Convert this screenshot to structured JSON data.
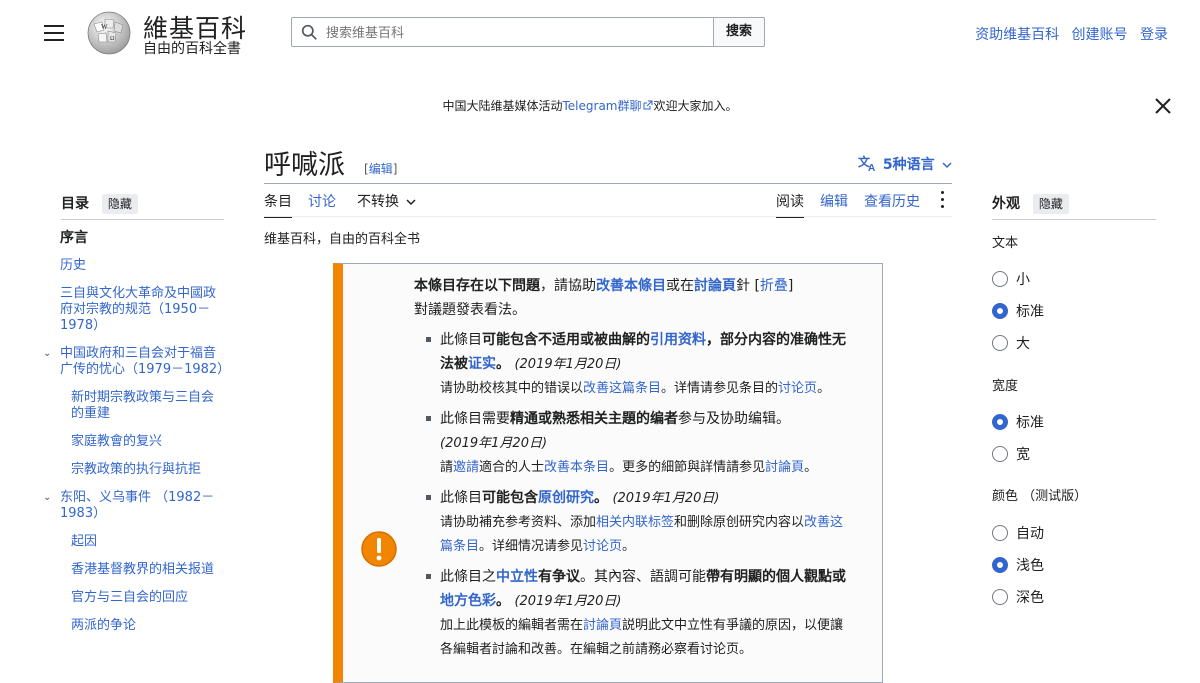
{
  "header": {
    "logo_name": "維基百科",
    "logo_tagline": "自由的百科全書",
    "search_placeholder": "搜索维基百科",
    "search_button": "搜索",
    "user_links": [
      "资助维基百科",
      "创建账号",
      "登录"
    ]
  },
  "banner": {
    "before": "中国大陆维基媒体活动",
    "link": "Telegram群聊",
    "after": "欢迎大家加入。"
  },
  "page": {
    "title": "呼喊派",
    "edit_label": "编辑",
    "languages": "5种语言",
    "from": "维基百科，自由的百科全书"
  },
  "tabs": {
    "left": [
      "条目",
      "讨论",
      "不转换"
    ],
    "right": [
      "阅读",
      "编辑",
      "查看历史"
    ]
  },
  "toc": {
    "title": "目录",
    "hide": "隐藏",
    "items": [
      "序言",
      "历史",
      "三自與文化大革命及中國政府对宗教的规范（1950－1978）",
      "中国政府和三自会对于福音广传的忧心（1979－1982）",
      "新时期宗教政策与三自会的重建",
      "家庭教會的复兴",
      "宗教政策的执行與抗拒",
      "东阳、义乌事件 （1982－1983）",
      "起因",
      "香港基督教界的相关报道",
      "官方与三自会的回应",
      "两派的争论"
    ]
  },
  "appearance": {
    "title": "外观",
    "hide": "隐藏",
    "text_label": "文本",
    "text_options": [
      "小",
      "标准",
      "大"
    ],
    "width_label": "宽度",
    "width_options": [
      "标准",
      "宽"
    ],
    "color_label": "颜色 （测试版）",
    "color_options": [
      "自动",
      "浅色",
      "深色"
    ]
  },
  "ambox": {
    "intro_bold": "本條目存在以下問題",
    "intro_1": "，請協助",
    "intro_link1": "改善本條目",
    "intro_2": "或在",
    "intro_link2": "討論頁",
    "intro_3": "針",
    "fold": "折叠",
    "intro_4": "對議題發表看法。",
    "items": [
      {
        "t1": "此條目",
        "b1": "可能包含不适用或被曲解的",
        "l1": "引用资料",
        "b2": "，部分内容的准确性无法被",
        "l2": "证实",
        "t2": "。",
        "date": "(2019年1月20日)",
        "s1": "请协助校核其中的错误以",
        "sl1": "改善这篇条目",
        "s2": "。详情请参见条目的",
        "sl2": "讨论页",
        "s3": "。"
      },
      {
        "t1": "此條目需要",
        "b1": "精通或熟悉相关主題的编者",
        "t2": "参与及协助编辑。",
        "date": "(2019年1月20日)",
        "s1": "請",
        "sl1": "邀請",
        "s2": "適合的人士",
        "sl2": "改善本条目",
        "s3": "。更多的細節與詳情請参见",
        "sl3": "討論頁",
        "s4": "。"
      },
      {
        "t1": "此條目",
        "b1": "可能包含",
        "l1": "原创研究",
        "t2": "。",
        "date": "(2019年1月20日)",
        "s1": "请协助補充参考资料、添加",
        "sl1": "相关内联标签",
        "s2": "和删除原创研究内容以",
        "sl2": "改善这篇条目",
        "s3": "。详细情况请参见",
        "sl3": "讨论页",
        "s4": "。"
      },
      {
        "t1": "此條目之",
        "l1": "中立性",
        "b1": "有争议",
        "t2": "。其內容、語調可能",
        "b2": "帶有明顯的個人觀點或",
        "l2": "地方色彩",
        "t3": "。",
        "date": "(2019年1月20日)",
        "s1": "加上此模板的編輯者需在",
        "sl1": "討論頁",
        "s2": "説明此文中立性有爭議的原因，以便讓各編輯者討論和改善。在編輯之前請務必察看讨论页。"
      }
    ]
  },
  "colors": {
    "link": "#3366cc",
    "warning": "#f28500",
    "text": "#202122"
  }
}
